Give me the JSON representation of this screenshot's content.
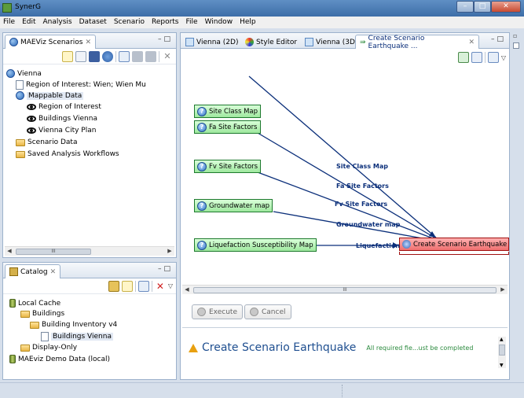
{
  "window": {
    "title": "SynerG"
  },
  "menu": [
    "File",
    "Edit",
    "Analysis",
    "Dataset",
    "Scenario",
    "Reports",
    "File",
    "Window",
    "Help"
  ],
  "scenarios_panel": {
    "tab_label": "MAEViz Scenarios",
    "tree": [
      {
        "label": "Vienna",
        "icon": "globe-icon",
        "level": 0
      },
      {
        "label": "Region of Interest: Wien; Wien Mu",
        "icon": "document-icon",
        "level": 1
      },
      {
        "label": "Mappable Data",
        "icon": "globe-icon",
        "level": 1,
        "selected": true
      },
      {
        "label": "Region of Interest",
        "icon": "eye-icon",
        "level": 2
      },
      {
        "label": "Buildings Vienna",
        "icon": "eye-icon",
        "level": 2
      },
      {
        "label": "Vienna City Plan",
        "icon": "eye-icon",
        "level": 2
      },
      {
        "label": "Scenario Data",
        "icon": "folder-icon",
        "level": 1
      },
      {
        "label": "Saved Analysis Workflows",
        "icon": "folder-icon",
        "level": 1
      }
    ],
    "scroll_label": "III"
  },
  "catalog_panel": {
    "tab_label": "Catalog",
    "tree": [
      {
        "label": "Local Cache",
        "icon": "database-icon",
        "level": 0
      },
      {
        "label": "Buildings",
        "icon": "folder-icon",
        "level": 1
      },
      {
        "label": "Building Inventory v4",
        "icon": "folder-icon",
        "level": 2
      },
      {
        "label": "Buildings Vienna",
        "icon": "document-icon",
        "level": 3,
        "selected": true
      },
      {
        "label": "Display-Only",
        "icon": "folder-icon",
        "level": 1
      },
      {
        "label": "MAEviz Demo Data (local)",
        "icon": "database-icon",
        "level": 0
      }
    ]
  },
  "editor_tabs": [
    {
      "label": "Vienna (2D)",
      "icon": "map-icon"
    },
    {
      "label": "Style Editor",
      "icon": "palette-icon"
    },
    {
      "label": "Vienna (3D)",
      "icon": "map-icon"
    },
    {
      "label": "Create Scenario Earthquake ...",
      "icon": "workflow-icon",
      "active": true
    }
  ],
  "workflow": {
    "inputs": [
      "Site Class Map",
      "Fa Site Factors",
      "Fv Site Factors",
      "Groundwater map",
      "Liquefaction Susceptibility Map"
    ],
    "target": "Create Scenario Earthquake",
    "edge_labels": [
      "Site Class Map",
      "Fa Site Factors",
      "Fv Site Factors",
      "Groundwater map",
      "Liquefaction"
    ],
    "scroll_label": "III"
  },
  "buttons": {
    "execute": "Execute",
    "cancel": "Cancel"
  },
  "message": {
    "title": "Create Scenario Earthquake",
    "detail": "All required fie...ust be completed"
  }
}
